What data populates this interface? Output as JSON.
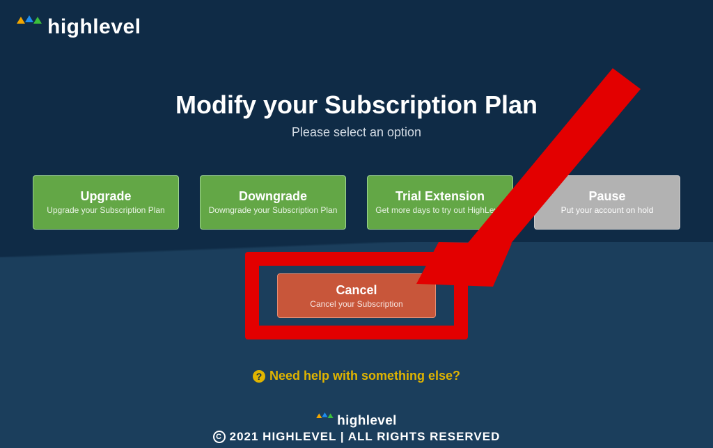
{
  "brand": {
    "name": "highlevel"
  },
  "header": {
    "title": "Modify your Subscription Plan",
    "subtitle": "Please select an option"
  },
  "options": {
    "upgrade": {
      "title": "Upgrade",
      "subtitle": "Upgrade your Subscription Plan"
    },
    "downgrade": {
      "title": "Downgrade",
      "subtitle": "Downgrade your Subscription Plan"
    },
    "trial": {
      "title": "Trial Extension",
      "subtitle": "Get more days to try out HighLevel"
    },
    "pause": {
      "title": "Pause",
      "subtitle": "Put your account on hold"
    },
    "cancel": {
      "title": "Cancel",
      "subtitle": "Cancel your Subscription"
    }
  },
  "help": {
    "text": "Need help with something else?"
  },
  "footer": {
    "copyright": "2021 HIGHLEVEL | ALL RIGHTS RESERVED"
  },
  "colors": {
    "green": "#63a746",
    "gray": "#b2b2b2",
    "cancel": "#c8563a",
    "accentYellow": "#e0b400",
    "annotationRed": "#e30000"
  }
}
